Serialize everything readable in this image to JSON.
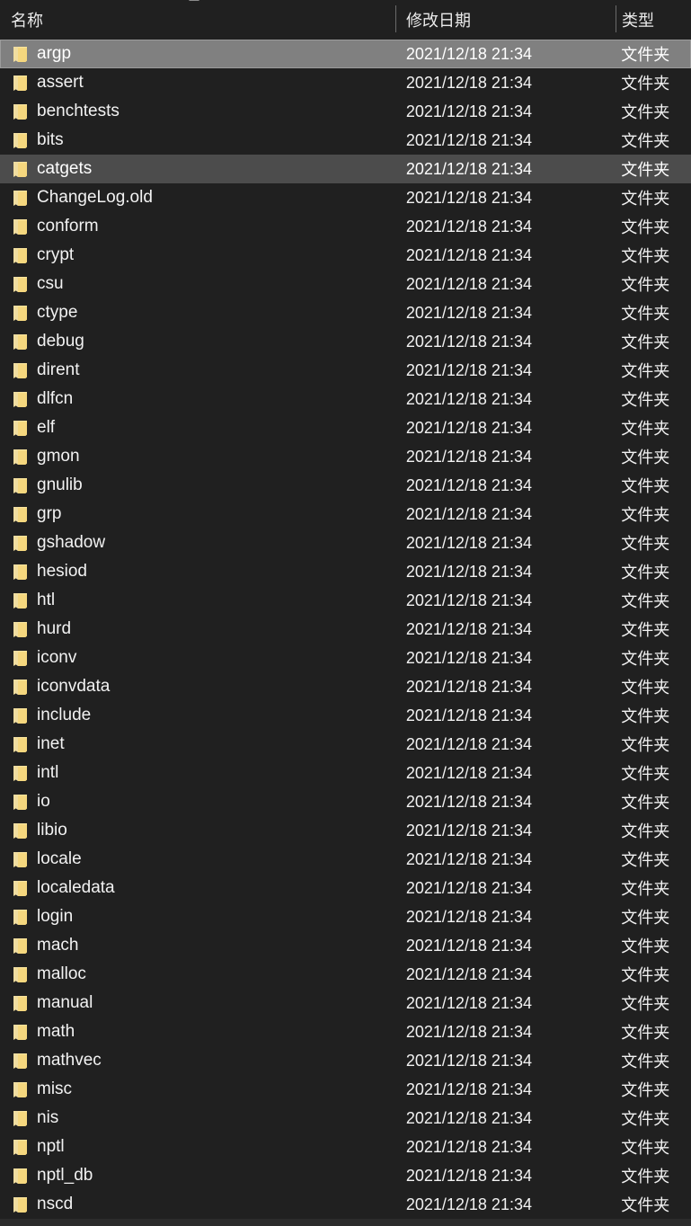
{
  "window": {
    "title": "File Explorer",
    "background_color": "#202020",
    "text_color": "#f2f2f2",
    "selection_color": "#808080",
    "hover_color": "#4c4c4c",
    "folder_icon_color": "#f5d77e"
  },
  "columns": {
    "name": "名称",
    "date_modified": "修改日期",
    "type": "类型",
    "sort_icon": "sort-ascending-icon"
  },
  "rows": [
    {
      "icon": "folder-icon",
      "name": "argp",
      "date": "2021/12/18 21:34",
      "type": "文件夹",
      "state": "selected"
    },
    {
      "icon": "folder-icon",
      "name": "assert",
      "date": "2021/12/18 21:34",
      "type": "文件夹",
      "state": "normal"
    },
    {
      "icon": "folder-icon",
      "name": "benchtests",
      "date": "2021/12/18 21:34",
      "type": "文件夹",
      "state": "normal"
    },
    {
      "icon": "folder-icon",
      "name": "bits",
      "date": "2021/12/18 21:34",
      "type": "文件夹",
      "state": "normal"
    },
    {
      "icon": "folder-icon",
      "name": "catgets",
      "date": "2021/12/18 21:34",
      "type": "文件夹",
      "state": "hover"
    },
    {
      "icon": "folder-icon",
      "name": "ChangeLog.old",
      "date": "2021/12/18 21:34",
      "type": "文件夹",
      "state": "normal"
    },
    {
      "icon": "folder-icon",
      "name": "conform",
      "date": "2021/12/18 21:34",
      "type": "文件夹",
      "state": "normal"
    },
    {
      "icon": "folder-icon",
      "name": "crypt",
      "date": "2021/12/18 21:34",
      "type": "文件夹",
      "state": "normal"
    },
    {
      "icon": "folder-icon",
      "name": "csu",
      "date": "2021/12/18 21:34",
      "type": "文件夹",
      "state": "normal"
    },
    {
      "icon": "folder-icon",
      "name": "ctype",
      "date": "2021/12/18 21:34",
      "type": "文件夹",
      "state": "normal"
    },
    {
      "icon": "folder-icon",
      "name": "debug",
      "date": "2021/12/18 21:34",
      "type": "文件夹",
      "state": "normal"
    },
    {
      "icon": "folder-icon",
      "name": "dirent",
      "date": "2021/12/18 21:34",
      "type": "文件夹",
      "state": "normal"
    },
    {
      "icon": "folder-icon",
      "name": "dlfcn",
      "date": "2021/12/18 21:34",
      "type": "文件夹",
      "state": "normal"
    },
    {
      "icon": "folder-icon",
      "name": "elf",
      "date": "2021/12/18 21:34",
      "type": "文件夹",
      "state": "normal"
    },
    {
      "icon": "folder-icon",
      "name": "gmon",
      "date": "2021/12/18 21:34",
      "type": "文件夹",
      "state": "normal"
    },
    {
      "icon": "folder-icon",
      "name": "gnulib",
      "date": "2021/12/18 21:34",
      "type": "文件夹",
      "state": "normal"
    },
    {
      "icon": "folder-icon",
      "name": "grp",
      "date": "2021/12/18 21:34",
      "type": "文件夹",
      "state": "normal"
    },
    {
      "icon": "folder-icon",
      "name": "gshadow",
      "date": "2021/12/18 21:34",
      "type": "文件夹",
      "state": "normal"
    },
    {
      "icon": "folder-icon",
      "name": "hesiod",
      "date": "2021/12/18 21:34",
      "type": "文件夹",
      "state": "normal"
    },
    {
      "icon": "folder-icon",
      "name": "htl",
      "date": "2021/12/18 21:34",
      "type": "文件夹",
      "state": "normal"
    },
    {
      "icon": "folder-icon",
      "name": "hurd",
      "date": "2021/12/18 21:34",
      "type": "文件夹",
      "state": "normal"
    },
    {
      "icon": "folder-icon",
      "name": "iconv",
      "date": "2021/12/18 21:34",
      "type": "文件夹",
      "state": "normal"
    },
    {
      "icon": "folder-icon",
      "name": "iconvdata",
      "date": "2021/12/18 21:34",
      "type": "文件夹",
      "state": "normal"
    },
    {
      "icon": "folder-icon",
      "name": "include",
      "date": "2021/12/18 21:34",
      "type": "文件夹",
      "state": "normal"
    },
    {
      "icon": "folder-icon",
      "name": "inet",
      "date": "2021/12/18 21:34",
      "type": "文件夹",
      "state": "normal"
    },
    {
      "icon": "folder-icon",
      "name": "intl",
      "date": "2021/12/18 21:34",
      "type": "文件夹",
      "state": "normal"
    },
    {
      "icon": "folder-icon",
      "name": "io",
      "date": "2021/12/18 21:34",
      "type": "文件夹",
      "state": "normal"
    },
    {
      "icon": "folder-icon",
      "name": "libio",
      "date": "2021/12/18 21:34",
      "type": "文件夹",
      "state": "normal"
    },
    {
      "icon": "folder-icon",
      "name": "locale",
      "date": "2021/12/18 21:34",
      "type": "文件夹",
      "state": "normal"
    },
    {
      "icon": "folder-icon",
      "name": "localedata",
      "date": "2021/12/18 21:34",
      "type": "文件夹",
      "state": "normal"
    },
    {
      "icon": "folder-icon",
      "name": "login",
      "date": "2021/12/18 21:34",
      "type": "文件夹",
      "state": "normal"
    },
    {
      "icon": "folder-icon",
      "name": "mach",
      "date": "2021/12/18 21:34",
      "type": "文件夹",
      "state": "normal"
    },
    {
      "icon": "folder-icon",
      "name": "malloc",
      "date": "2021/12/18 21:34",
      "type": "文件夹",
      "state": "normal"
    },
    {
      "icon": "folder-icon",
      "name": "manual",
      "date": "2021/12/18 21:34",
      "type": "文件夹",
      "state": "normal"
    },
    {
      "icon": "folder-icon",
      "name": "math",
      "date": "2021/12/18 21:34",
      "type": "文件夹",
      "state": "normal"
    },
    {
      "icon": "folder-icon",
      "name": "mathvec",
      "date": "2021/12/18 21:34",
      "type": "文件夹",
      "state": "normal"
    },
    {
      "icon": "folder-icon",
      "name": "misc",
      "date": "2021/12/18 21:34",
      "type": "文件夹",
      "state": "normal"
    },
    {
      "icon": "folder-icon",
      "name": "nis",
      "date": "2021/12/18 21:34",
      "type": "文件夹",
      "state": "normal"
    },
    {
      "icon": "folder-icon",
      "name": "nptl",
      "date": "2021/12/18 21:34",
      "type": "文件夹",
      "state": "normal"
    },
    {
      "icon": "folder-icon",
      "name": "nptl_db",
      "date": "2021/12/18 21:34",
      "type": "文件夹",
      "state": "normal"
    },
    {
      "icon": "folder-icon",
      "name": "nscd",
      "date": "2021/12/18 21:34",
      "type": "文件夹",
      "state": "normal"
    }
  ],
  "scrollbar": {
    "orientation": "horizontal",
    "name": "horizontal-scrollbar"
  }
}
